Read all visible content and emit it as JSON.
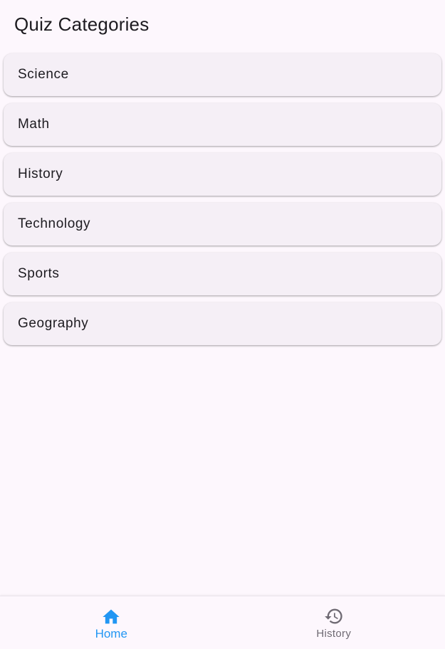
{
  "app_bar": {
    "title": "Quiz Categories"
  },
  "categories": [
    {
      "label": "Science"
    },
    {
      "label": "Math"
    },
    {
      "label": "History"
    },
    {
      "label": "Technology"
    },
    {
      "label": "Sports"
    },
    {
      "label": "Geography"
    }
  ],
  "bottom_nav": {
    "items": [
      {
        "label": "Home",
        "icon": "home-icon",
        "active": true
      },
      {
        "label": "History",
        "icon": "history-icon",
        "active": false
      }
    ],
    "active_color": "#2196f3",
    "inactive_color": "#6f6a73"
  }
}
